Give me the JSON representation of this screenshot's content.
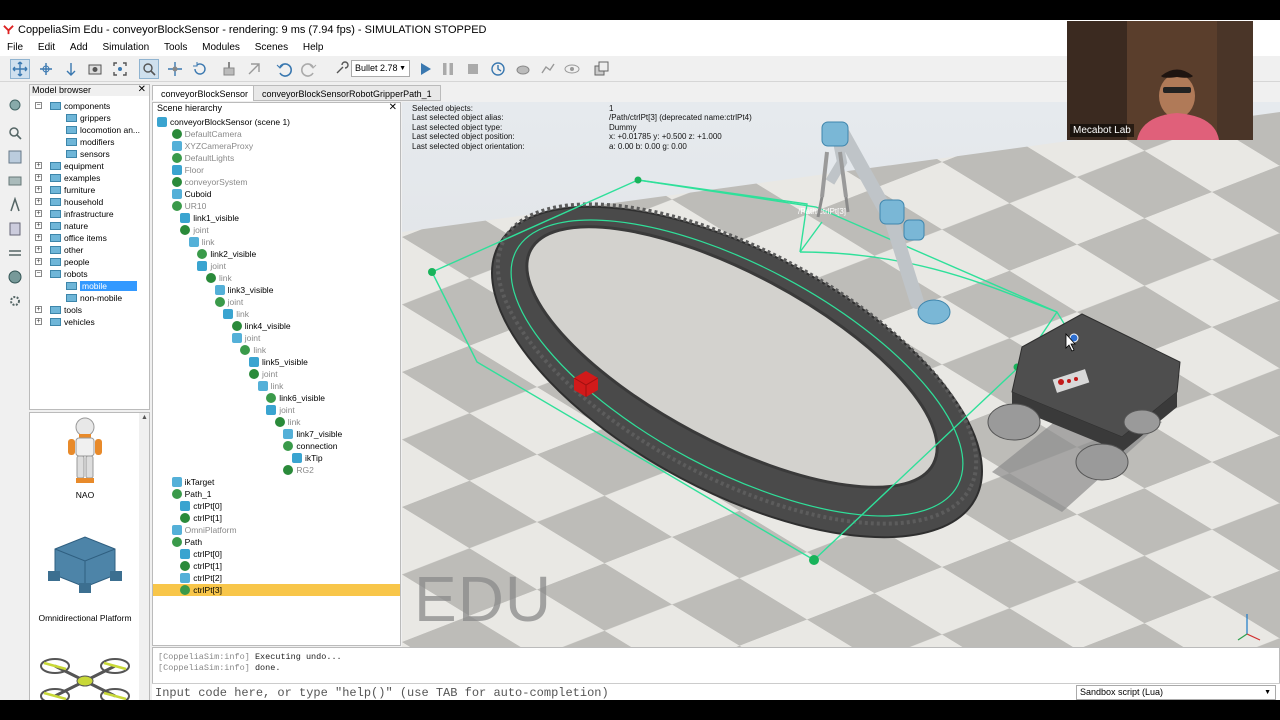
{
  "window": {
    "title": "CoppeliaSim Edu - conveyorBlockSensor - rendering: 9 ms (7.94 fps) - SIMULATION STOPPED"
  },
  "menu": [
    "File",
    "Edit",
    "Add",
    "Simulation",
    "Tools",
    "Modules",
    "Scenes",
    "Help"
  ],
  "toolbar": {
    "physics_engine": "Bullet 2.78",
    "icons": [
      "camera-pan-icon",
      "camera-rotate-icon",
      "camera-shift-icon",
      "camera-angle-icon",
      "fit-to-view-icon",
      "object-select-icon",
      "object-shift-icon",
      "object-rotate-icon",
      "assemble-icon",
      "transfer-dna-icon",
      "undo-icon",
      "redo-icon",
      "engine-icon",
      "play-icon",
      "pause-icon",
      "stop-icon",
      "realtime-icon",
      "slow-icon",
      "fast-icon",
      "visualization-icon",
      "scene-selector-icon"
    ]
  },
  "model_browser": {
    "title": "Model browser",
    "items": [
      {
        "label": "components",
        "level": 0,
        "expanded": true
      },
      {
        "label": "grippers",
        "level": 1
      },
      {
        "label": "locomotion an...",
        "level": 1
      },
      {
        "label": "modifiers",
        "level": 1
      },
      {
        "label": "sensors",
        "level": 1
      },
      {
        "label": "equipment",
        "level": 0
      },
      {
        "label": "examples",
        "level": 0
      },
      {
        "label": "furniture",
        "level": 0
      },
      {
        "label": "household",
        "level": 0
      },
      {
        "label": "infrastructure",
        "level": 0
      },
      {
        "label": "nature",
        "level": 0
      },
      {
        "label": "office items",
        "level": 0
      },
      {
        "label": "other",
        "level": 0
      },
      {
        "label": "people",
        "level": 0
      },
      {
        "label": "robots",
        "level": 0,
        "expanded": true
      },
      {
        "label": "mobile",
        "level": 1,
        "selected": true
      },
      {
        "label": "non-mobile",
        "level": 1
      },
      {
        "label": "tools",
        "level": 0
      },
      {
        "label": "vehicles",
        "level": 0
      }
    ],
    "thumbnails": [
      "NAO",
      "Omnidirectional Platform",
      ""
    ]
  },
  "tabs": [
    "conveyorBlockSensor",
    "conveyorBlockSensorRobotGripperPath_1"
  ],
  "scene_hierarchy": {
    "title": "Scene hierarchy",
    "items": [
      {
        "label": "conveyorBlockSensor (scene 1)",
        "depth": 0
      },
      {
        "label": "DefaultCamera",
        "depth": 1,
        "dim": true
      },
      {
        "label": "XYZCameraProxy",
        "depth": 1,
        "dim": true
      },
      {
        "label": "DefaultLights",
        "depth": 1,
        "dim": true
      },
      {
        "label": "Floor",
        "depth": 1,
        "dim": true
      },
      {
        "label": "conveyorSystem",
        "depth": 1,
        "dim": true
      },
      {
        "label": "Cuboid",
        "depth": 1
      },
      {
        "label": "UR10",
        "depth": 1,
        "dim": true
      },
      {
        "label": "link1_visible",
        "depth": 2
      },
      {
        "label": "joint",
        "depth": 2,
        "dim": true
      },
      {
        "label": "link",
        "depth": 3,
        "dim": true
      },
      {
        "label": "link2_visible",
        "depth": 4
      },
      {
        "label": "joint",
        "depth": 4,
        "dim": true
      },
      {
        "label": "link",
        "depth": 5,
        "dim": true
      },
      {
        "label": "link3_visible",
        "depth": 6
      },
      {
        "label": "joint",
        "depth": 6,
        "dim": true
      },
      {
        "label": "link",
        "depth": 7,
        "dim": true
      },
      {
        "label": "link4_visible",
        "depth": 8
      },
      {
        "label": "joint",
        "depth": 8,
        "dim": true
      },
      {
        "label": "link",
        "depth": 9,
        "dim": true
      },
      {
        "label": "link5_visible",
        "depth": 10
      },
      {
        "label": "joint",
        "depth": 10,
        "dim": true
      },
      {
        "label": "link",
        "depth": 11,
        "dim": true
      },
      {
        "label": "link6_visible",
        "depth": 12
      },
      {
        "label": "joint",
        "depth": 12,
        "dim": true
      },
      {
        "label": "link",
        "depth": 13,
        "dim": true
      },
      {
        "label": "link7_visible",
        "depth": 14
      },
      {
        "label": "connection",
        "depth": 14
      },
      {
        "label": "ikTip",
        "depth": 15
      },
      {
        "label": "RG2",
        "depth": 14,
        "dim": true
      },
      {
        "label": "ikTarget",
        "depth": 1
      },
      {
        "label": "Path_1",
        "depth": 1
      },
      {
        "label": "ctrlPt[0]",
        "depth": 2
      },
      {
        "label": "ctrlPt[1]",
        "depth": 2
      },
      {
        "label": "OmniPlatform",
        "depth": 1,
        "dim": true
      },
      {
        "label": "Path",
        "depth": 1
      },
      {
        "label": "ctrlPt[0]",
        "depth": 2
      },
      {
        "label": "ctrlPt[1]",
        "depth": 2
      },
      {
        "label": "ctrlPt[2]",
        "depth": 2
      },
      {
        "label": "ctrlPt[3]",
        "depth": 2,
        "selected": true
      }
    ]
  },
  "selection_info": [
    {
      "key": "Selected objects:",
      "value": "1"
    },
    {
      "key": "Last selected object alias:",
      "value": "/Path/ctrlPt[3]    (deprecated name:ctrlPt4)"
    },
    {
      "key": "Last selected object type:",
      "value": "Dummy"
    },
    {
      "key": "Last selected object position:",
      "value": "x: +0.01785   y: +0.500   z: +1.000"
    },
    {
      "key": "Last selected object orientation:",
      "value": "a: 0.00   b: 0.00   g: 0.00"
    }
  ],
  "viewport": {
    "watermark": "EDU",
    "path_label": "/Path/ctrlPt[3]"
  },
  "console": {
    "lines": [
      {
        "tag": "[CoppeliaSim:info]",
        "text": "Executing undo..."
      },
      {
        "tag": "[CoppeliaSim:info]",
        "text": "done."
      }
    ],
    "input_placeholder": "Input code here, or type \"help()\" (use TAB for auto-completion)",
    "script_type": "Sandbox script (Lua)"
  },
  "webcam": {
    "name": "Mecabot Lab"
  },
  "colors": {
    "path": "#2fe09a",
    "floor_light": "#e8e6e2",
    "floor_dark": "#b9b8b4",
    "highlight": "#f8c64a",
    "selection": "#3399ff"
  }
}
